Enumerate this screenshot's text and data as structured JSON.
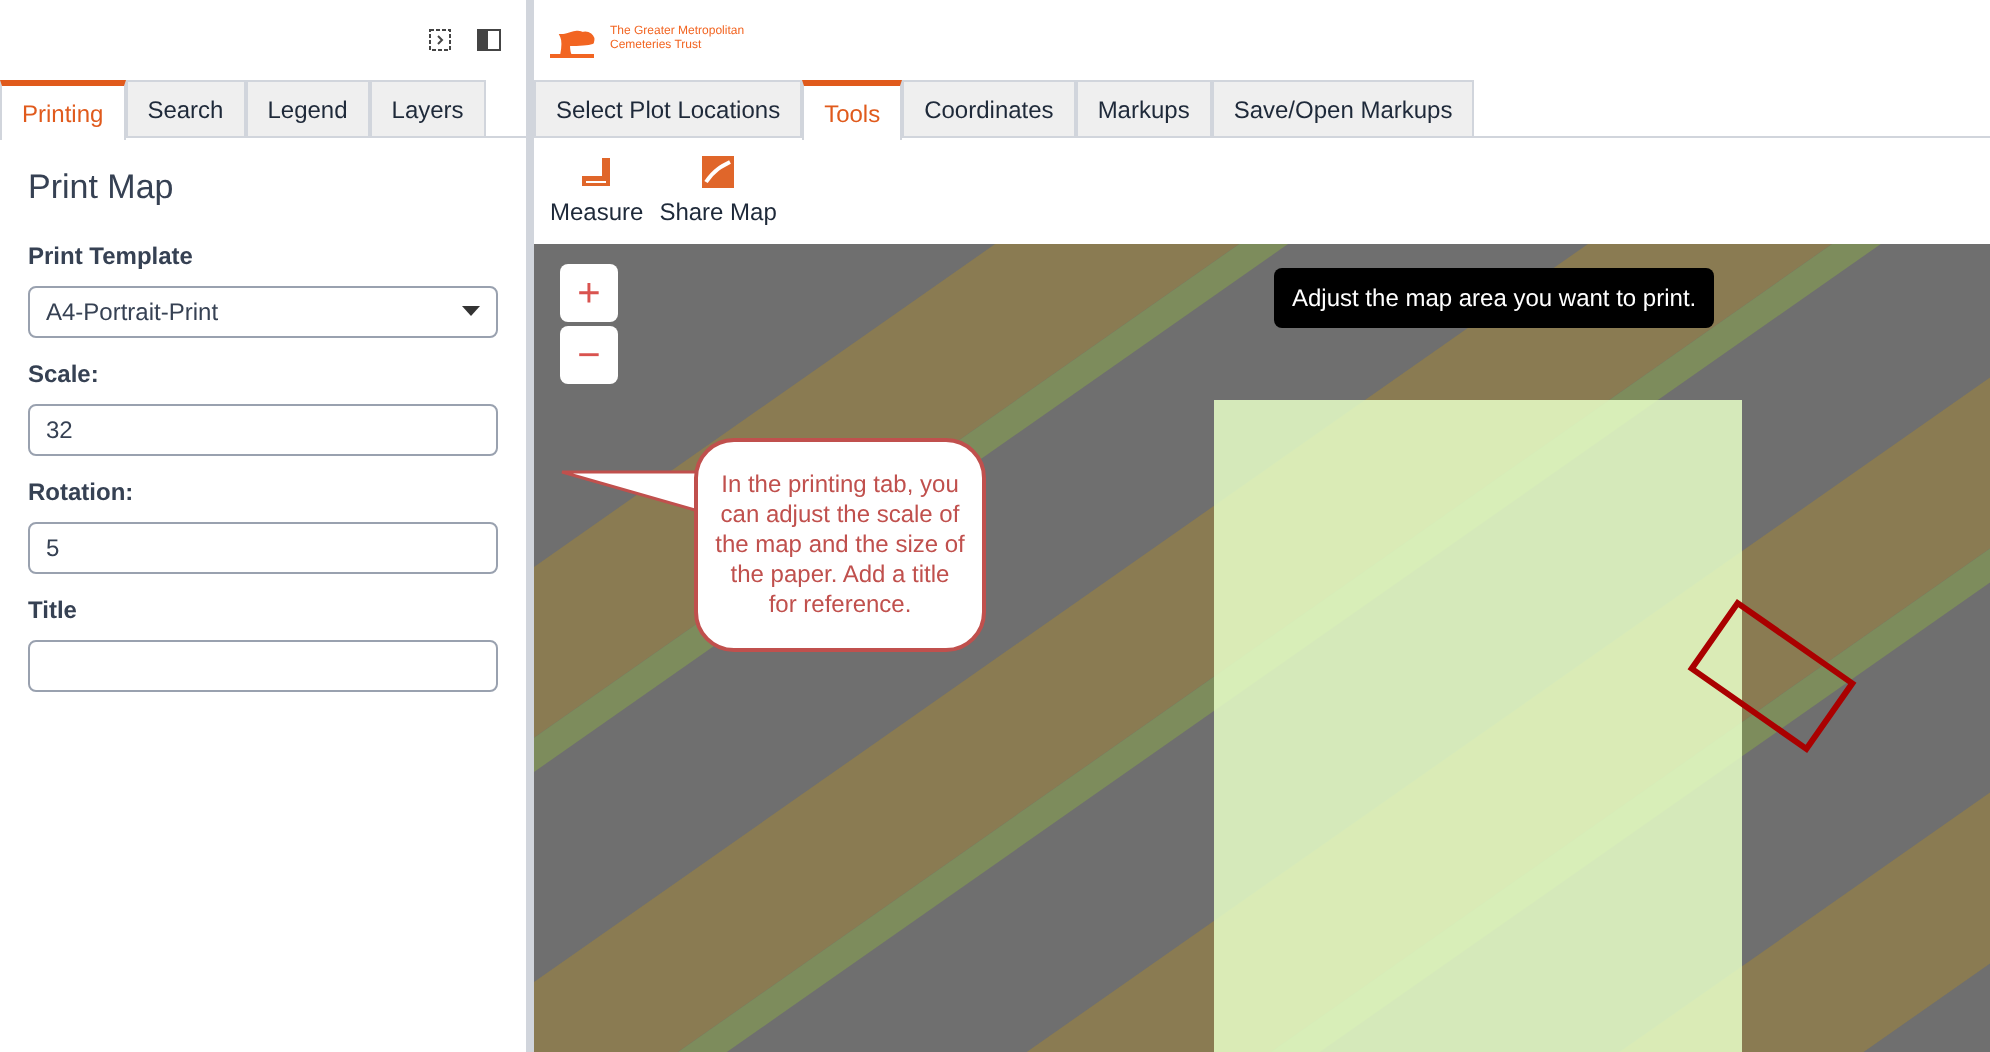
{
  "logo": {
    "text": "The Greater Metropolitan Cemeteries Trust"
  },
  "left_tabs": [
    {
      "label": "Printing",
      "selected": true
    },
    {
      "label": "Search",
      "selected": false
    },
    {
      "label": "Legend",
      "selected": false
    },
    {
      "label": "Layers",
      "selected": false
    }
  ],
  "panel": {
    "title": "Print Map",
    "fields": [
      {
        "kind": "select",
        "label": "Print Template",
        "value": "A4-Portrait-Print"
      },
      {
        "kind": "text",
        "label": "Scale:",
        "value": "32"
      },
      {
        "kind": "text",
        "label": "Rotation:",
        "value": "5"
      },
      {
        "kind": "text",
        "label": "Title"
      }
    ]
  },
  "map_tabs": [
    {
      "label": "Select Plot Locations",
      "selected": false
    },
    {
      "label": "Tools",
      "selected": true
    },
    {
      "label": "Coordinates",
      "selected": false
    },
    {
      "label": "Markups",
      "selected": false
    },
    {
      "label": "Save/Open Markups",
      "selected": false
    }
  ],
  "toolbar": [
    {
      "kind": "measure",
      "label": "Measure"
    },
    {
      "kind": "share",
      "label": "Share Map"
    }
  ],
  "map": {
    "zoom_in": "+",
    "zoom_out": "−",
    "tooltip": "Adjust the map area you want to print.",
    "callout": "In the printing tab, you can adjust the scale of the map and the size of the paper.  Add a title for reference."
  }
}
